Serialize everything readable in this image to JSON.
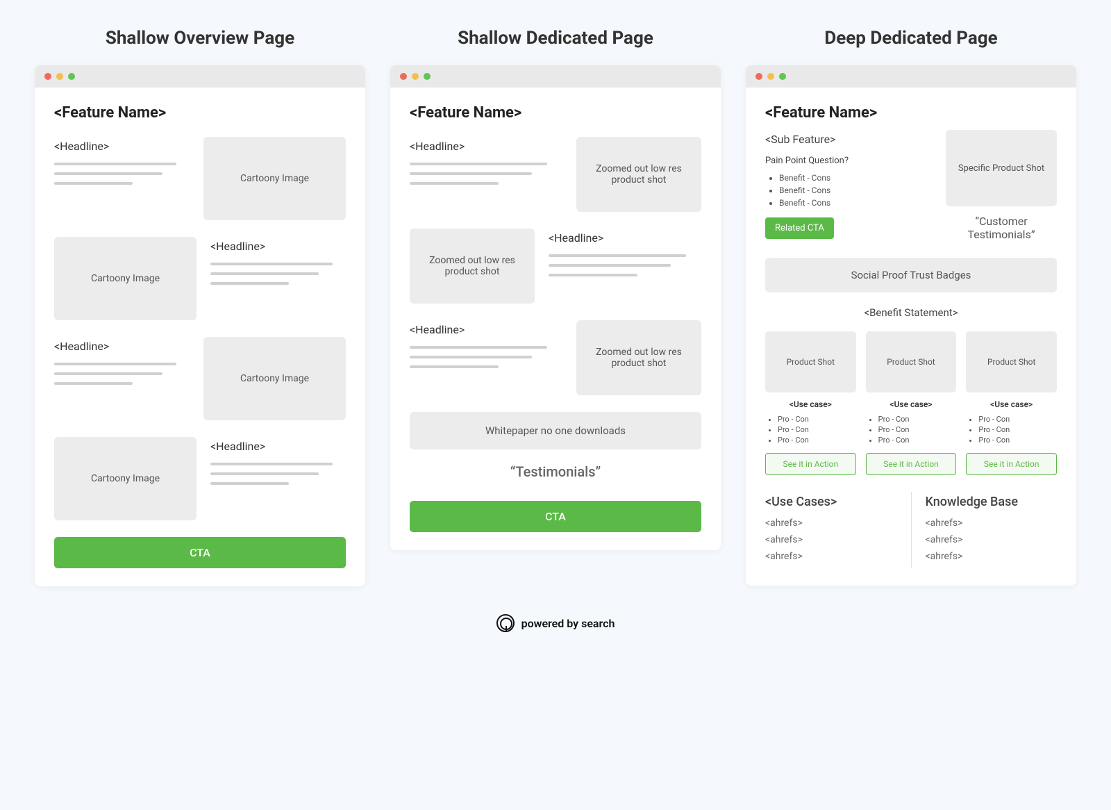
{
  "columns": [
    {
      "title": "Shallow Overview Page",
      "feature_name": "<Feature Name>",
      "rows": [
        {
          "headline": "<Headline>",
          "img_label": "Cartoony Image",
          "reverse": false
        },
        {
          "headline": "<Headline>",
          "img_label": "Cartoony Image",
          "reverse": true
        },
        {
          "headline": "<Headline>",
          "img_label": "Cartoony Image",
          "reverse": false
        },
        {
          "headline": "<Headline>",
          "img_label": "Cartoony Image",
          "reverse": true
        }
      ],
      "cta": "CTA"
    },
    {
      "title": "Shallow Dedicated Page",
      "feature_name": "<Feature Name>",
      "rows": [
        {
          "headline": "<Headline>",
          "img_label": "Zoomed out low res product shot",
          "reverse": false
        },
        {
          "headline": "<Headline>",
          "img_label": "Zoomed out low res product shot",
          "reverse": true
        },
        {
          "headline": "<Headline>",
          "img_label": "Zoomed out low res product shot",
          "reverse": false
        }
      ],
      "whitepaper": "Whitepaper no one downloads",
      "testimonials": "“Testimonials”",
      "cta": "CTA"
    },
    {
      "title": "Deep Dedicated Page",
      "feature_name": "<Feature Name>",
      "sub_feature": "<Sub Feature>",
      "pain_point": "Pain Point Question?",
      "benefits": [
        "Benefit - Cons",
        "Benefit - Cons",
        "Benefit - Cons"
      ],
      "related_cta": "Related CTA",
      "specific_shot": "Specific Product Shot",
      "customer_testimonials": "“Customer Testimonials”",
      "trust_badges": "Social Proof Trust Badges",
      "benefit_statement": "<Benefit Statement>",
      "cards": [
        {
          "shot": "Product Shot",
          "usecase": "<Use case>",
          "procons": [
            "Pro - Con",
            "Pro - Con",
            "Pro - Con"
          ],
          "btn": "See it in Action"
        },
        {
          "shot": "Product Shot",
          "usecase": "<Use case>",
          "procons": [
            "Pro - Con",
            "Pro - Con",
            "Pro - Con"
          ],
          "btn": "See it in Action"
        },
        {
          "shot": "Product Shot",
          "usecase": "<Use case>",
          "procons": [
            "Pro - Con",
            "Pro - Con",
            "Pro - Con"
          ],
          "btn": "See it in Action"
        }
      ],
      "bottom": {
        "usecases_title": "<Use Cases>",
        "usecases_links": [
          "<ahrefs>",
          "<ahrefs>",
          "<ahrefs>"
        ],
        "kb_title": "Knowledge Base",
        "kb_links": [
          "<ahrefs>",
          "<ahrefs>",
          "<ahrefs>"
        ]
      }
    }
  ],
  "footer": "powered by search"
}
